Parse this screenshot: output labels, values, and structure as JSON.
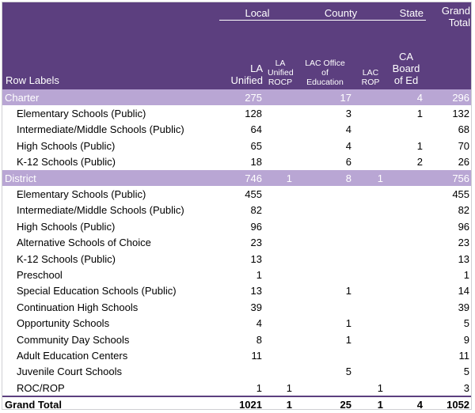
{
  "header": {
    "groups": {
      "local": "Local",
      "county": "County",
      "state": "State",
      "grand_total": "Grand\nTotal"
    },
    "row_labels": "Row Labels",
    "columns": [
      "LA\nUnified",
      "LA\nUnified\nROCP",
      "LAC Office\nof\nEducation",
      "LAC\nROP",
      "CA\nBoard\nof Ed"
    ]
  },
  "sections": [
    {
      "name": "Charter",
      "totals": [
        "275",
        "",
        "17",
        "",
        "4",
        "296"
      ],
      "rows": [
        {
          "label": "Elementary Schools (Public)",
          "values": [
            "128",
            "",
            "3",
            "",
            "1",
            "132"
          ]
        },
        {
          "label": "Intermediate/Middle Schools (Public)",
          "values": [
            "64",
            "",
            "4",
            "",
            "",
            "68"
          ]
        },
        {
          "label": "High Schools (Public)",
          "values": [
            "65",
            "",
            "4",
            "",
            "1",
            "70"
          ]
        },
        {
          "label": "K-12 Schools (Public)",
          "values": [
            "18",
            "",
            "6",
            "",
            "2",
            "26"
          ]
        }
      ]
    },
    {
      "name": "District",
      "totals": [
        "746",
        "1",
        "8",
        "1",
        "",
        "756"
      ],
      "rows": [
        {
          "label": "Elementary Schools (Public)",
          "values": [
            "455",
            "",
            "",
            "",
            "",
            "455"
          ]
        },
        {
          "label": "Intermediate/Middle Schools (Public)",
          "values": [
            "82",
            "",
            "",
            "",
            "",
            "82"
          ]
        },
        {
          "label": "High Schools (Public)",
          "values": [
            "96",
            "",
            "",
            "",
            "",
            "96"
          ]
        },
        {
          "label": "Alternative Schools of Choice",
          "values": [
            "23",
            "",
            "",
            "",
            "",
            "23"
          ]
        },
        {
          "label": "K-12 Schools (Public)",
          "values": [
            "13",
            "",
            "",
            "",
            "",
            "13"
          ]
        },
        {
          "label": "Preschool",
          "values": [
            "1",
            "",
            "",
            "",
            "",
            "1"
          ]
        },
        {
          "label": "Special Education Schools (Public)",
          "values": [
            "13",
            "",
            "1",
            "",
            "",
            "14"
          ]
        },
        {
          "label": "Continuation High Schools",
          "values": [
            "39",
            "",
            "",
            "",
            "",
            "39"
          ]
        },
        {
          "label": "Opportunity Schools",
          "values": [
            "4",
            "",
            "1",
            "",
            "",
            "5"
          ]
        },
        {
          "label": "Community Day Schools",
          "values": [
            "8",
            "",
            "1",
            "",
            "",
            "9"
          ]
        },
        {
          "label": "Adult Education Centers",
          "values": [
            "11",
            "",
            "",
            "",
            "",
            "11"
          ]
        },
        {
          "label": "Juvenile Court Schools",
          "values": [
            "",
            "",
            "5",
            "",
            "",
            "5"
          ]
        },
        {
          "label": "ROC/ROP",
          "values": [
            "1",
            "1",
            "",
            "1",
            "",
            "3"
          ]
        }
      ]
    }
  ],
  "grand_total": {
    "label": "Grand Total",
    "values": [
      "1021",
      "1",
      "25",
      "1",
      "4",
      "1052"
    ]
  }
}
